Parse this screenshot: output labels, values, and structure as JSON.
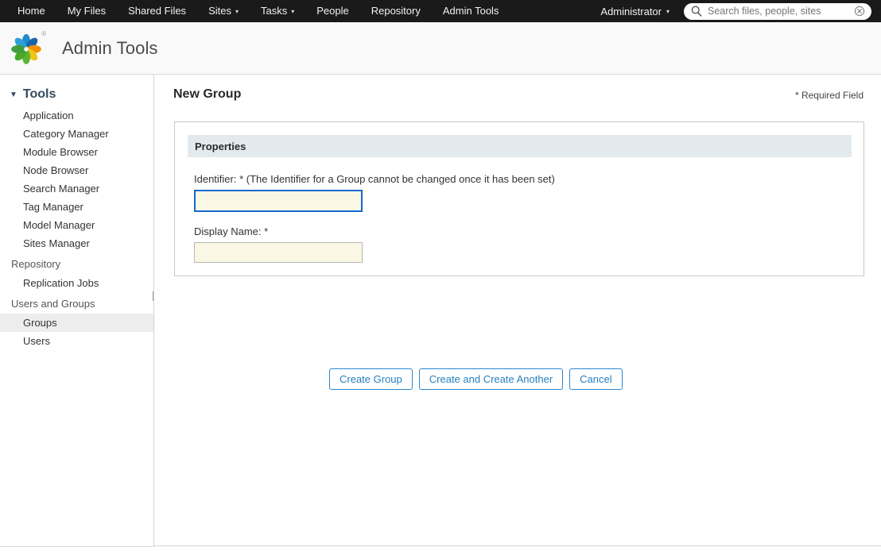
{
  "topnav": {
    "items": [
      {
        "label": "Home",
        "has_caret": false
      },
      {
        "label": "My Files",
        "has_caret": false
      },
      {
        "label": "Shared Files",
        "has_caret": false
      },
      {
        "label": "Sites",
        "has_caret": true
      },
      {
        "label": "Tasks",
        "has_caret": true
      },
      {
        "label": "People",
        "has_caret": false
      },
      {
        "label": "Repository",
        "has_caret": false
      },
      {
        "label": "Admin Tools",
        "has_caret": false
      }
    ],
    "user_label": "Administrator",
    "caret_glyph": "▾",
    "search": {
      "placeholder": "Search files, people, sites",
      "value": "",
      "icon": "search-icon",
      "clear_icon": "clear-circle-icon"
    }
  },
  "appheader": {
    "title": "Admin Tools",
    "logo": "alfresco-pinwheel-logo",
    "registered_mark": "®"
  },
  "sidebar": {
    "tools_group": {
      "label": "Tools",
      "triangle": "▼",
      "items": [
        {
          "label": "Application",
          "selected": false
        },
        {
          "label": "Category Manager",
          "selected": false
        },
        {
          "label": "Module Browser",
          "selected": false
        },
        {
          "label": "Node Browser",
          "selected": false
        },
        {
          "label": "Search Manager",
          "selected": false
        },
        {
          "label": "Tag Manager",
          "selected": false
        },
        {
          "label": "Model Manager",
          "selected": false
        },
        {
          "label": "Sites Manager",
          "selected": false
        }
      ]
    },
    "repository_group": {
      "label": "Repository",
      "items": [
        {
          "label": "Replication Jobs",
          "selected": false
        }
      ]
    },
    "users_group": {
      "label": "Users and Groups",
      "items": [
        {
          "label": "Groups",
          "selected": true
        },
        {
          "label": "Users",
          "selected": false
        }
      ]
    }
  },
  "main": {
    "page_title": "New Group",
    "required_note": "* Required Field",
    "panel": {
      "header": "Properties",
      "fields": [
        {
          "label": "Identifier: * (The Identifier for a Group cannot be changed once it has been set)",
          "value": "",
          "placeholder": "",
          "focused": true
        },
        {
          "label": "Display Name: *",
          "value": "",
          "placeholder": "",
          "focused": false
        }
      ]
    },
    "buttons": [
      {
        "label": "Create Group"
      },
      {
        "label": "Create and Create Another"
      },
      {
        "label": "Cancel"
      }
    ]
  },
  "colors": {
    "topbar_bg": "#1a1a1a",
    "accent_blue": "#2680c2",
    "focus_blue": "#1469cd",
    "field_bg": "#faf8e4",
    "panel_header_bg": "#e3eaee",
    "selected_row_bg": "#ededed"
  }
}
